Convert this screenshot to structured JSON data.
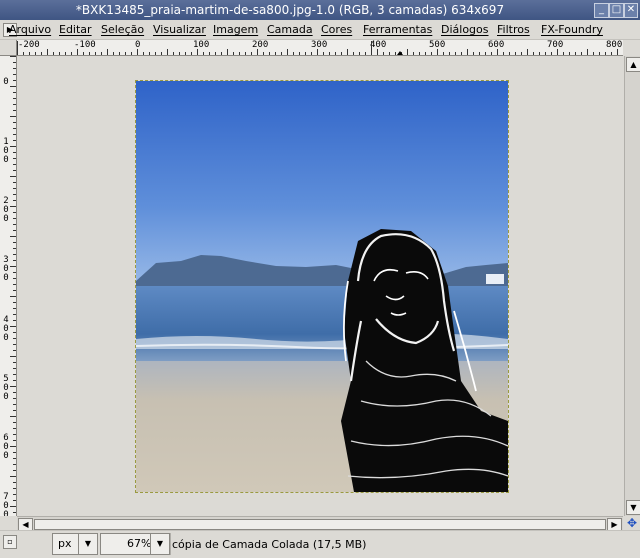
{
  "window": {
    "title": "*BXK13485_praia-martim-de-sa800.jpg-1.0 (RGB, 3 camadas) 634x697",
    "buttons": [
      "_",
      "□",
      "✕"
    ]
  },
  "menu": {
    "items": [
      "Arquivo",
      "Editar",
      "Seleção",
      "Visualizar",
      "Imagem",
      "Camada",
      "Cores",
      "Ferramentas",
      "Diálogos",
      "Filtros",
      "FX-Foundry"
    ]
  },
  "ruler": {
    "h_labels": [
      "-200",
      "-100",
      "0",
      "100",
      "200",
      "300",
      "400",
      "500",
      "600",
      "700",
      "800"
    ],
    "v_labels": [
      "0",
      "100",
      "200",
      "300",
      "400",
      "500",
      "600",
      "700"
    ]
  },
  "status": {
    "unit": "px",
    "zoom": "67%",
    "message": "cópia de Camada Colada (17,5 MB)"
  },
  "colors": {
    "sky_top": "#3a6fd0",
    "sky_bottom": "#8fb3e8",
    "sea": "#4f7db8",
    "sand": "#c9c1b0"
  }
}
